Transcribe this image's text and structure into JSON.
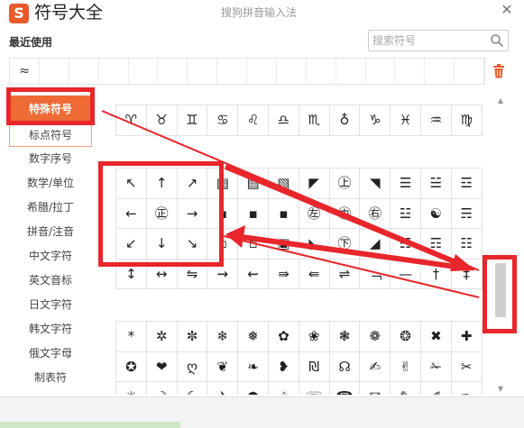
{
  "app": {
    "logo": "S",
    "title": "符号大全",
    "ime_name": "搜狗拼音输入法",
    "close": "✕"
  },
  "recent": {
    "label": "最近使用",
    "items": [
      "≈"
    ]
  },
  "search": {
    "placeholder": "搜索符号"
  },
  "sidebar": {
    "items": [
      {
        "label": "特殊符号",
        "state": "active"
      },
      {
        "label": "标点符号",
        "state": "hover"
      },
      {
        "label": "数字序号",
        "state": "normal"
      },
      {
        "label": "数学/单位",
        "state": "normal"
      },
      {
        "label": "希腊/拉丁",
        "state": "normal"
      },
      {
        "label": "拼音/注音",
        "state": "normal"
      },
      {
        "label": "中文字符",
        "state": "normal"
      },
      {
        "label": "英文音标",
        "state": "normal"
      },
      {
        "label": "日文字符",
        "state": "normal"
      },
      {
        "label": "韩文字符",
        "state": "normal"
      },
      {
        "label": "俄文字母",
        "state": "normal"
      },
      {
        "label": "制表符",
        "state": "normal"
      }
    ]
  },
  "grid1": {
    "rows": [
      [
        "♈",
        "♉",
        "♊",
        "♋",
        "♌",
        "♎",
        "♏",
        "♁",
        "♑",
        "♓",
        "♒",
        "♍"
      ]
    ]
  },
  "grid2": {
    "rows": [
      [
        "↖",
        "↑",
        "↗",
        "▤",
        "▤",
        "▧",
        "◤",
        "㊤",
        "◥",
        "☰",
        "☱",
        "☲"
      ],
      [
        "←",
        "㊣",
        "→",
        "▪",
        "▪",
        "▪",
        "㊧",
        "㊥",
        "㊨",
        "☳",
        "☯",
        "☴"
      ],
      [
        "↙",
        "↓",
        "↘",
        "▫",
        "▫",
        "▣",
        "◣",
        "㊦",
        "◢",
        "☵",
        "☶",
        "☷"
      ],
      [
        "↕",
        "↔",
        "⇋",
        "⇝",
        "⇜",
        "⇛",
        "⇚",
        "⇌",
        "﹁",
        "—",
        "†",
        "‡"
      ]
    ]
  },
  "grid3": {
    "rows": [
      [
        "*",
        "✲",
        "✼",
        "❄",
        "❅",
        "✿",
        "❀",
        "❃",
        "❁",
        "❂",
        "✖",
        "✚"
      ],
      [
        "✪",
        "❤",
        "ღ",
        "❦",
        "❧",
        "❥",
        "₪",
        "☊",
        "✍",
        "✌",
        "✁",
        "✂"
      ],
      [
        "☼",
        "☽",
        "☾",
        "✈",
        "☂",
        "☃",
        "☏",
        "☎",
        "✉",
        "✎",
        "✐",
        "✑"
      ]
    ]
  },
  "scrollbar": {
    "up": "▲",
    "down": "▼"
  },
  "colors": {
    "accent": "#ef6b35",
    "annotation": "#e8262b"
  }
}
